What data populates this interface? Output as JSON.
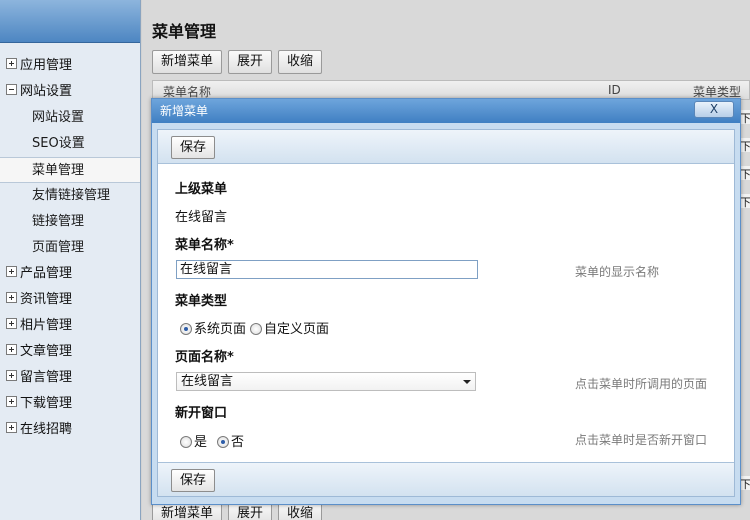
{
  "sidebar": {
    "items": [
      {
        "label": "应用管理",
        "level": "top",
        "toggle": "plus"
      },
      {
        "label": "网站设置",
        "level": "top",
        "toggle": "minus"
      },
      {
        "label": "网站设置",
        "level": "sub"
      },
      {
        "label": "SEO设置",
        "level": "sub"
      },
      {
        "label": "菜单管理",
        "level": "sub",
        "active": true
      },
      {
        "label": "友情链接管理",
        "level": "sub"
      },
      {
        "label": "链接管理",
        "level": "sub"
      },
      {
        "label": "页面管理",
        "level": "sub"
      },
      {
        "label": "产品管理",
        "level": "top",
        "toggle": "plus"
      },
      {
        "label": "资讯管理",
        "level": "top",
        "toggle": "plus"
      },
      {
        "label": "相片管理",
        "level": "top",
        "toggle": "plus"
      },
      {
        "label": "文章管理",
        "level": "top",
        "toggle": "plus"
      },
      {
        "label": "留言管理",
        "level": "top",
        "toggle": "plus"
      },
      {
        "label": "下载管理",
        "level": "top",
        "toggle": "plus"
      },
      {
        "label": "在线招聘",
        "level": "top",
        "toggle": "plus"
      }
    ]
  },
  "main": {
    "title": "菜单管理",
    "toolbar": {
      "add": "新增菜单",
      "expand": "展开",
      "collapse": "收缩"
    },
    "grid": {
      "columns": [
        "菜单名称",
        "ID",
        "菜单类型"
      ]
    },
    "row_edge_text": "下"
  },
  "dialog": {
    "title": "新增菜单",
    "close_label": "X",
    "save_label": "保存",
    "parent_menu": {
      "label": "上级菜单",
      "value": "在线留言"
    },
    "menu_name": {
      "label": "菜单名称*",
      "value": "在线留言",
      "hint": "菜单的显示名称"
    },
    "menu_type": {
      "label": "菜单类型",
      "options": [
        "系统页面",
        "自定义页面"
      ],
      "selected": "系统页面"
    },
    "page_name": {
      "label": "页面名称*",
      "value": "在线留言",
      "hint": "点击菜单时所调用的页面"
    },
    "new_window": {
      "label": "新开窗口",
      "options": [
        "是",
        "否"
      ],
      "selected": "否",
      "hint": "点击菜单时是否新开窗口"
    }
  },
  "colors": {
    "accent": "#4d86c2",
    "sidebar_bg": "#e4ebf3",
    "dialog_border": "#5b8fc9"
  }
}
